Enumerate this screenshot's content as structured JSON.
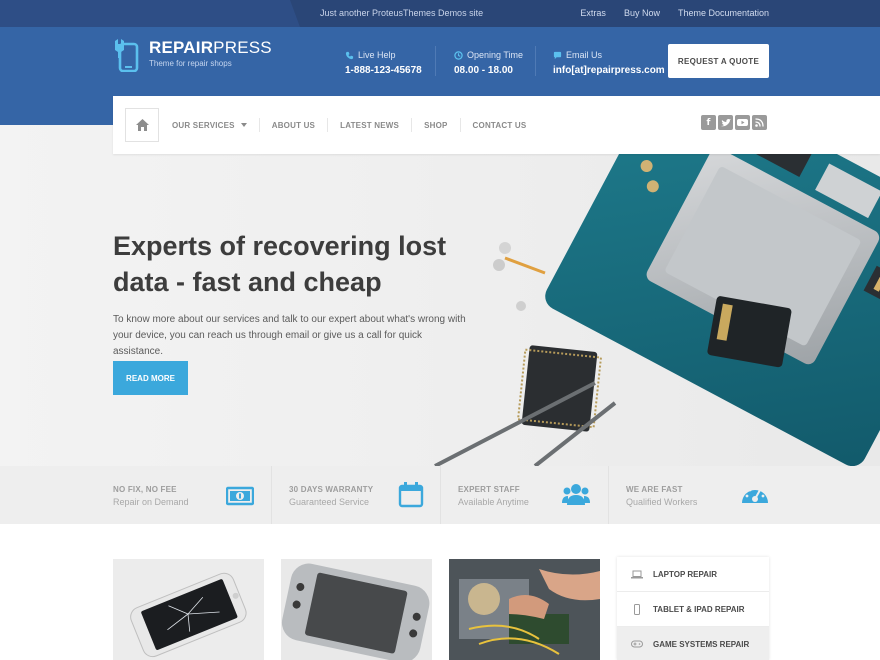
{
  "topbar": {
    "tagline": "Just another ProteusThemes Demos site",
    "links": [
      "Extras",
      "Buy Now",
      "Theme Documentation"
    ]
  },
  "brand": {
    "title_bold": "REPAIR",
    "title_light": "PRESS",
    "subtitle": "Theme for repair shops",
    "icon": "phone-wrench-icon"
  },
  "contacts": [
    {
      "label": "Live Help",
      "value": "1-888-123-45678",
      "icon": "phone-icon"
    },
    {
      "label": "Opening Time",
      "value": "08.00 - 18.00",
      "icon": "clock-icon"
    },
    {
      "label": "Email Us",
      "value": "info[at]repairpress.com",
      "icon": "chat-icon"
    }
  ],
  "quote_button": "REQUEST A QUOTE",
  "nav": {
    "home_icon": "home-icon",
    "items": [
      "OUR SERVICES",
      "ABOUT US",
      "LATEST NEWS",
      "SHOP",
      "CONTACT US"
    ],
    "social": [
      "facebook-icon",
      "twitter-icon",
      "youtube-icon",
      "rss-icon"
    ]
  },
  "hero": {
    "title": "Experts of recovering lost data - fast and cheap",
    "text": "To know more about our services and talk to our expert about what's wrong with your device, you can reach us through email or give us a call for quick assistance.",
    "button": "READ MORE"
  },
  "features": [
    {
      "title": "NO FIX, NO FEE",
      "subtitle": "Repair on Demand",
      "icon": "money-icon"
    },
    {
      "title": "30 DAYS WARRANTY",
      "subtitle": "Guaranteed Service",
      "icon": "calendar-icon"
    },
    {
      "title": "EXPERT STAFF",
      "subtitle": "Available Anytime",
      "icon": "users-icon"
    },
    {
      "title": "WE ARE FAST",
      "subtitle": "Qualified Workers",
      "icon": "speedometer-icon"
    }
  ],
  "services": [
    {
      "label": "LAPTOP REPAIR",
      "icon": "laptop-icon"
    },
    {
      "label": "TABLET & IPAD REPAIR",
      "icon": "tablet-icon"
    },
    {
      "label": "GAME SYSTEMS REPAIR",
      "icon": "gamepad-icon"
    }
  ],
  "colors": {
    "header": "#3565a6",
    "topbar": "#2a4677",
    "accent": "#3ba8dc"
  }
}
